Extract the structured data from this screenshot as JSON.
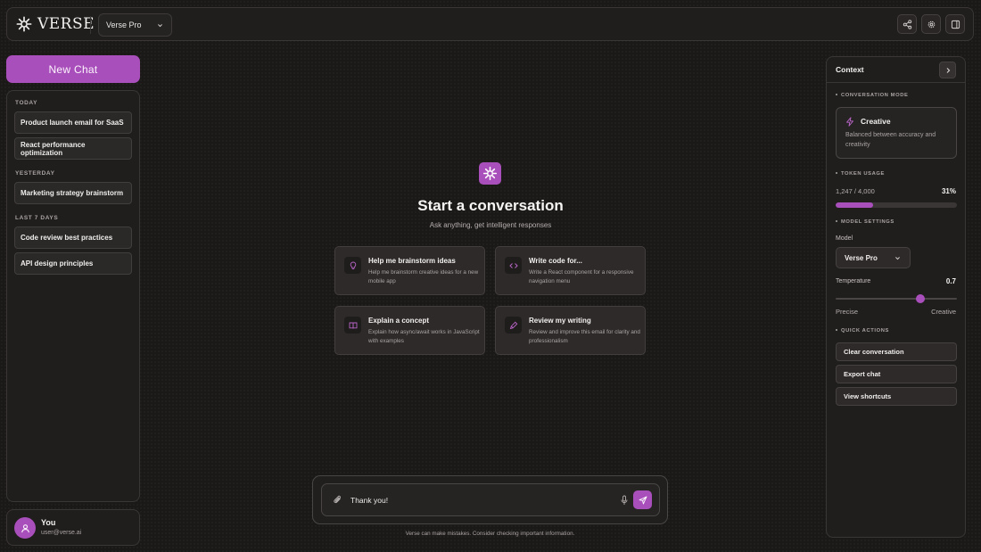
{
  "app": {
    "brand": "VERSE",
    "model_selector": "Verse Pro"
  },
  "sidebar": {
    "new_chat_label": "New Chat",
    "groups": [
      {
        "label": "TODAY",
        "items": [
          "Product launch email for SaaS",
          "React performance optimization"
        ]
      },
      {
        "label": "YESTERDAY",
        "items": [
          "Marketing strategy brainstorm"
        ]
      },
      {
        "label": "LAST 7 DAYS",
        "items": [
          "Code review best practices",
          "API design principles"
        ]
      }
    ],
    "user": {
      "name": "You",
      "email": "user@verse.ai"
    }
  },
  "main": {
    "title": "Start a conversation",
    "subtitle": "Ask anything, get intelligent responses",
    "suggestions": [
      {
        "title": "Help me brainstorm ideas",
        "desc": "Help me brainstorm creative ideas for a new mobile app",
        "icon": "lightbulb-icon"
      },
      {
        "title": "Write code for...",
        "desc": "Write a React component for a responsive navigation menu",
        "icon": "code-icon"
      },
      {
        "title": "Explain a concept",
        "desc": "Explain how async/await works in JavaScript with examples",
        "icon": "book-icon"
      },
      {
        "title": "Review my writing",
        "desc": "Review and improve this email for clarity and professionalism",
        "icon": "pen-icon"
      }
    ],
    "input_value": "Thank you!",
    "disclaimer": "Verse can make mistakes. Consider checking important information."
  },
  "context": {
    "title": "Context",
    "mode_label": "CONVERSATION MODE",
    "mode_name": "Creative",
    "mode_desc": "Balanced between accuracy and creativity",
    "token_label": "TOKEN USAGE",
    "token_count": "1,247 / 4,000",
    "token_percent_text": "31%",
    "token_fraction": 0.31,
    "settings_label": "MODEL SETTINGS",
    "model_label": "Model",
    "model_value": "Verse Pro",
    "temperature_label": "Temperature",
    "temperature_value": "0.7",
    "temperature_fraction": 0.7,
    "temp_min_label": "Precise",
    "temp_max_label": "Creative",
    "quick_actions_label": "QUICK ACTIONS",
    "quick_actions": [
      "Clear conversation",
      "Export chat",
      "View shortcuts"
    ]
  },
  "colors": {
    "accent": "#a94fbb",
    "background": "#1b1818",
    "panel": "#201d1d"
  }
}
